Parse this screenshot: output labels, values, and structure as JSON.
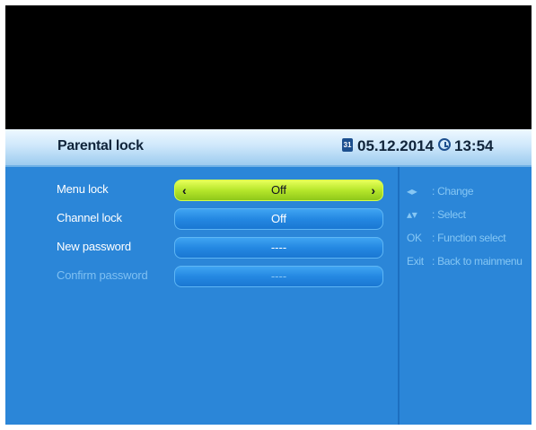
{
  "header": {
    "title": "Parental lock",
    "calendar_icon_label": "31",
    "date": "05.12.2014",
    "time": "13:54"
  },
  "rows": [
    {
      "label": "Menu lock",
      "value": "Off",
      "left_arrow": "‹",
      "right_arrow": "›"
    },
    {
      "label": "Channel lock",
      "value": "Off"
    },
    {
      "label": "New password",
      "value": "----"
    },
    {
      "label": "Confirm password",
      "value": "----"
    }
  ],
  "help": [
    {
      "key": "◂▸",
      "text": ": Change"
    },
    {
      "key": "▴▾",
      "text": ": Select"
    },
    {
      "key": "OK",
      "text": ": Function select"
    },
    {
      "key": "Exit",
      "text": ": Back to mainmenu"
    }
  ],
  "colors": {
    "panel": "#2b86d8",
    "selected_field": "#b6e62b",
    "field": "#2488e2"
  }
}
